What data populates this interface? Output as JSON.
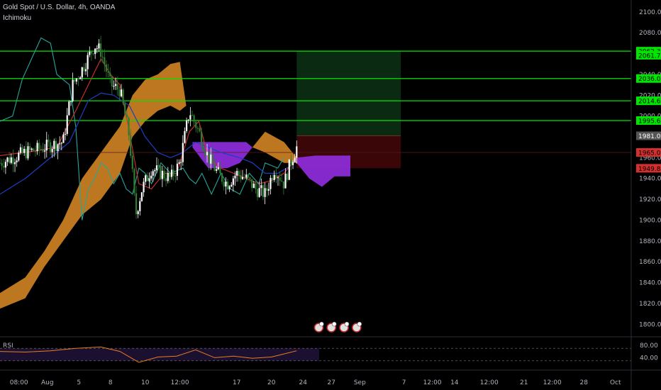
{
  "header": {
    "title": "Gold Spot / U.S. Dollar, 4h, OANDA",
    "indicator": "Ichimoku"
  },
  "rsi": {
    "label": "RSI",
    "ticks": [
      "80.00",
      "40.00"
    ]
  },
  "colors": {
    "background": "#000000",
    "candle": "#ffffff",
    "candle_down": "#2e7d32",
    "tenkan": "#d32f2f",
    "kijun": "#1e3fbf",
    "chikou": "#26a69a",
    "chikou2": "#9ccc65",
    "kumo_bull": "#c77d22",
    "kumo_bear": "#8b2bd6",
    "level_line": "#00e600",
    "target_zone": "#0a2a12",
    "stop_zone": "#3a0608",
    "entry_line": "#5c1a1a",
    "rsi_line": "#e87e1e",
    "rsi_band": "#1c1030"
  },
  "chart_data": {
    "type": "candlestick",
    "title": "Gold Spot / U.S. Dollar, 4h, OANDA",
    "y_ticks": [
      "2100.000",
      "2080.000",
      "2060.000",
      "2040.000",
      "2020.000",
      "2000.000",
      "1980.000",
      "1960.000",
      "1940.000",
      "1920.000",
      "1900.000",
      "1880.000",
      "1860.000",
      "1840.000",
      "1820.000",
      "1800.000"
    ],
    "y_tick_values": [
      2100,
      2080,
      2060,
      2040,
      2020,
      2000,
      1980,
      1960,
      1940,
      1920,
      1900,
      1880,
      1860,
      1840,
      1820,
      1800
    ],
    "ylim": [
      1790,
      2106
    ],
    "x_ticks": [
      "08:00",
      "Aug",
      "5",
      "8",
      "10",
      "12:00",
      "17",
      "20",
      "24",
      "27",
      "Sep",
      "7",
      "12:00",
      "14",
      "12:00",
      "21",
      "12:00",
      "28",
      "Oct"
    ],
    "x_tick_positions": [
      0.03,
      0.075,
      0.125,
      0.175,
      0.23,
      0.285,
      0.375,
      0.43,
      0.48,
      0.525,
      0.57,
      0.64,
      0.685,
      0.72,
      0.775,
      0.83,
      0.875,
      0.925,
      0.975
    ],
    "price_levels": [
      {
        "label": "2062.323",
        "value": 2062.323,
        "color": "#00e600",
        "line": true
      },
      {
        "label": "2061.711",
        "value": 2058.4,
        "color": "#00e600",
        "line": false
      },
      {
        "label": "2036.037",
        "value": 2036.037,
        "color": "#00e600",
        "line": true
      },
      {
        "label": "2014.642",
        "value": 2014.642,
        "color": "#00e600",
        "line": true
      },
      {
        "label": "1995.692",
        "value": 1995.692,
        "color": "#00e600",
        "line": true
      },
      {
        "label": "1981.021",
        "value": 1981.021,
        "color": "#555555",
        "line": false
      },
      {
        "label": "1965.026",
        "value": 1965.026,
        "color": "#d32f2f",
        "line": false
      },
      {
        "label": "1949.845",
        "value": 1949.845,
        "color": "#d32f2f",
        "line": false
      }
    ],
    "position": {
      "entry": 1981.0,
      "target": 2062.3,
      "stop": 1949.8,
      "x_start": 0.47,
      "x_end": 0.635
    },
    "last_price": 1965.026,
    "close_path": [
      {
        "x": 0.0,
        "y": 1955
      },
      {
        "x": 0.02,
        "y": 1960
      },
      {
        "x": 0.04,
        "y": 1965
      },
      {
        "x": 0.06,
        "y": 1968
      },
      {
        "x": 0.08,
        "y": 1972
      },
      {
        "x": 0.1,
        "y": 1975
      },
      {
        "x": 0.115,
        "y": 2030
      },
      {
        "x": 0.13,
        "y": 2045
      },
      {
        "x": 0.15,
        "y": 2068
      },
      {
        "x": 0.16,
        "y": 2062
      },
      {
        "x": 0.175,
        "y": 2030
      },
      {
        "x": 0.19,
        "y": 2025
      },
      {
        "x": 0.205,
        "y": 1980
      },
      {
        "x": 0.215,
        "y": 1905
      },
      {
        "x": 0.225,
        "y": 1930
      },
      {
        "x": 0.24,
        "y": 1950
      },
      {
        "x": 0.255,
        "y": 1945
      },
      {
        "x": 0.27,
        "y": 1940
      },
      {
        "x": 0.285,
        "y": 1955
      },
      {
        "x": 0.3,
        "y": 2005
      },
      {
        "x": 0.315,
        "y": 1985
      },
      {
        "x": 0.33,
        "y": 1960
      },
      {
        "x": 0.345,
        "y": 1945
      },
      {
        "x": 0.36,
        "y": 1935
      },
      {
        "x": 0.375,
        "y": 1945
      },
      {
        "x": 0.39,
        "y": 1940
      },
      {
        "x": 0.405,
        "y": 1930
      },
      {
        "x": 0.42,
        "y": 1925
      },
      {
        "x": 0.435,
        "y": 1950
      },
      {
        "x": 0.45,
        "y": 1935
      },
      {
        "x": 0.46,
        "y": 1955
      },
      {
        "x": 0.47,
        "y": 1970
      }
    ],
    "tenkan": [
      {
        "x": 0.0,
        "y": 1962
      },
      {
        "x": 0.05,
        "y": 1966
      },
      {
        "x": 0.09,
        "y": 1970
      },
      {
        "x": 0.12,
        "y": 2005
      },
      {
        "x": 0.14,
        "y": 2030
      },
      {
        "x": 0.16,
        "y": 2055
      },
      {
        "x": 0.175,
        "y": 2040
      },
      {
        "x": 0.19,
        "y": 2030
      },
      {
        "x": 0.205,
        "y": 1985
      },
      {
        "x": 0.22,
        "y": 1935
      },
      {
        "x": 0.24,
        "y": 1930
      },
      {
        "x": 0.26,
        "y": 1945
      },
      {
        "x": 0.28,
        "y": 1945
      },
      {
        "x": 0.3,
        "y": 1985
      },
      {
        "x": 0.315,
        "y": 1995
      },
      {
        "x": 0.33,
        "y": 1960
      },
      {
        "x": 0.35,
        "y": 1950
      },
      {
        "x": 0.37,
        "y": 1945
      },
      {
        "x": 0.39,
        "y": 1940
      },
      {
        "x": 0.41,
        "y": 1935
      },
      {
        "x": 0.43,
        "y": 1938
      },
      {
        "x": 0.45,
        "y": 1945
      },
      {
        "x": 0.47,
        "y": 1960
      }
    ],
    "kijun": [
      {
        "x": 0.0,
        "y": 1925
      },
      {
        "x": 0.04,
        "y": 1940
      },
      {
        "x": 0.08,
        "y": 1960
      },
      {
        "x": 0.11,
        "y": 1975
      },
      {
        "x": 0.14,
        "y": 2015
      },
      {
        "x": 0.16,
        "y": 2022
      },
      {
        "x": 0.18,
        "y": 2020
      },
      {
        "x": 0.205,
        "y": 2010
      },
      {
        "x": 0.23,
        "y": 1980
      },
      {
        "x": 0.25,
        "y": 1965
      },
      {
        "x": 0.27,
        "y": 1960
      },
      {
        "x": 0.29,
        "y": 1965
      },
      {
        "x": 0.31,
        "y": 1975
      },
      {
        "x": 0.33,
        "y": 1970
      },
      {
        "x": 0.35,
        "y": 1965
      },
      {
        "x": 0.38,
        "y": 1960
      },
      {
        "x": 0.4,
        "y": 1955
      },
      {
        "x": 0.42,
        "y": 1945
      },
      {
        "x": 0.44,
        "y": 1945
      },
      {
        "x": 0.46,
        "y": 1952
      },
      {
        "x": 0.47,
        "y": 1958
      }
    ],
    "chikou": [
      {
        "x": 0.0,
        "y": 1995
      },
      {
        "x": 0.02,
        "y": 2000
      },
      {
        "x": 0.035,
        "y": 2035
      },
      {
        "x": 0.05,
        "y": 2055
      },
      {
        "x": 0.065,
        "y": 2075
      },
      {
        "x": 0.08,
        "y": 2070
      },
      {
        "x": 0.09,
        "y": 2040
      },
      {
        "x": 0.1,
        "y": 2035
      },
      {
        "x": 0.11,
        "y": 2030
      },
      {
        "x": 0.12,
        "y": 1990
      },
      {
        "x": 0.13,
        "y": 1900
      },
      {
        "x": 0.14,
        "y": 1930
      },
      {
        "x": 0.15,
        "y": 1940
      },
      {
        "x": 0.16,
        "y": 1955
      },
      {
        "x": 0.17,
        "y": 1950
      },
      {
        "x": 0.18,
        "y": 1935
      },
      {
        "x": 0.19,
        "y": 1945
      },
      {
        "x": 0.2,
        "y": 1930
      },
      {
        "x": 0.21,
        "y": 1925
      },
      {
        "x": 0.22,
        "y": 1950
      },
      {
        "x": 0.23,
        "y": 1945
      },
      {
        "x": 0.24,
        "y": 1935
      },
      {
        "x": 0.255,
        "y": 1955
      },
      {
        "x": 0.27,
        "y": 1945
      },
      {
        "x": 0.29,
        "y": 1950
      },
      {
        "x": 0.3,
        "y": 1940
      },
      {
        "x": 0.31,
        "y": 1935
      },
      {
        "x": 0.32,
        "y": 1945
      },
      {
        "x": 0.335,
        "y": 1925
      },
      {
        "x": 0.35,
        "y": 1945
      },
      {
        "x": 0.365,
        "y": 1930
      },
      {
        "x": 0.38,
        "y": 1925
      },
      {
        "x": 0.395,
        "y": 1945
      },
      {
        "x": 0.41,
        "y": 1935
      },
      {
        "x": 0.42,
        "y": 1955
      },
      {
        "x": 0.44,
        "y": 1950
      },
      {
        "x": 0.45,
        "y": 1960
      }
    ],
    "kumo_bull": {
      "upper": [
        {
          "x": 0.0,
          "y": 1830
        },
        {
          "x": 0.04,
          "y": 1845
        },
        {
          "x": 0.07,
          "y": 1870
        },
        {
          "x": 0.1,
          "y": 1900
        },
        {
          "x": 0.13,
          "y": 1940
        },
        {
          "x": 0.16,
          "y": 1965
        },
        {
          "x": 0.19,
          "y": 1990
        },
        {
          "x": 0.21,
          "y": 2020
        },
        {
          "x": 0.23,
          "y": 2035
        },
        {
          "x": 0.25,
          "y": 2040
        },
        {
          "x": 0.27,
          "y": 2050
        },
        {
          "x": 0.285,
          "y": 2052
        },
        {
          "x": 0.295,
          "y": 2010
        }
      ],
      "lower": [
        {
          "x": 0.0,
          "y": 1815
        },
        {
          "x": 0.04,
          "y": 1825
        },
        {
          "x": 0.07,
          "y": 1855
        },
        {
          "x": 0.1,
          "y": 1880
        },
        {
          "x": 0.13,
          "y": 1905
        },
        {
          "x": 0.16,
          "y": 1920
        },
        {
          "x": 0.19,
          "y": 1945
        },
        {
          "x": 0.21,
          "y": 1980
        },
        {
          "x": 0.23,
          "y": 1995
        },
        {
          "x": 0.25,
          "y": 2005
        },
        {
          "x": 0.27,
          "y": 2010
        },
        {
          "x": 0.285,
          "y": 2005
        },
        {
          "x": 0.295,
          "y": 2010
        }
      ]
    },
    "kumo_bear": [
      {
        "upper": [
          {
            "x": 0.305,
            "y": 1975
          },
          {
            "x": 0.33,
            "y": 1975
          },
          {
            "x": 0.36,
            "y": 1975
          },
          {
            "x": 0.39,
            "y": 1975
          },
          {
            "x": 0.4,
            "y": 1970
          }
        ],
        "lower": [
          {
            "x": 0.305,
            "y": 1970
          },
          {
            "x": 0.33,
            "y": 1950
          },
          {
            "x": 0.36,
            "y": 1950
          },
          {
            "x": 0.38,
            "y": 1955
          },
          {
            "x": 0.4,
            "y": 1970
          }
        ]
      },
      {
        "upper": [
          {
            "x": 0.47,
            "y": 1960
          },
          {
            "x": 0.5,
            "y": 1962
          },
          {
            "x": 0.53,
            "y": 1962
          },
          {
            "x": 0.555,
            "y": 1962
          }
        ],
        "lower": [
          {
            "x": 0.47,
            "y": 1955
          },
          {
            "x": 0.49,
            "y": 1940
          },
          {
            "x": 0.51,
            "y": 1932
          },
          {
            "x": 0.53,
            "y": 1942
          },
          {
            "x": 0.555,
            "y": 1942
          }
        ]
      }
    ],
    "kumo_bull2": {
      "upper": [
        {
          "x": 0.4,
          "y": 1970
        },
        {
          "x": 0.42,
          "y": 1985
        },
        {
          "x": 0.435,
          "y": 1980
        },
        {
          "x": 0.45,
          "y": 1975
        },
        {
          "x": 0.47,
          "y": 1960
        }
      ],
      "lower": [
        {
          "x": 0.4,
          "y": 1970
        },
        {
          "x": 0.42,
          "y": 1965
        },
        {
          "x": 0.435,
          "y": 1960
        },
        {
          "x": 0.45,
          "y": 1955
        },
        {
          "x": 0.47,
          "y": 1955
        }
      ]
    },
    "events_count": 4,
    "rsi_path": [
      {
        "x": 0.0,
        "y": 60
      },
      {
        "x": 0.04,
        "y": 58
      },
      {
        "x": 0.08,
        "y": 62
      },
      {
        "x": 0.12,
        "y": 70
      },
      {
        "x": 0.16,
        "y": 74
      },
      {
        "x": 0.19,
        "y": 60
      },
      {
        "x": 0.22,
        "y": 25
      },
      {
        "x": 0.25,
        "y": 42
      },
      {
        "x": 0.28,
        "y": 45
      },
      {
        "x": 0.31,
        "y": 65
      },
      {
        "x": 0.34,
        "y": 40
      },
      {
        "x": 0.37,
        "y": 45
      },
      {
        "x": 0.4,
        "y": 38
      },
      {
        "x": 0.43,
        "y": 42
      },
      {
        "x": 0.45,
        "y": 52
      },
      {
        "x": 0.47,
        "y": 62
      }
    ]
  }
}
